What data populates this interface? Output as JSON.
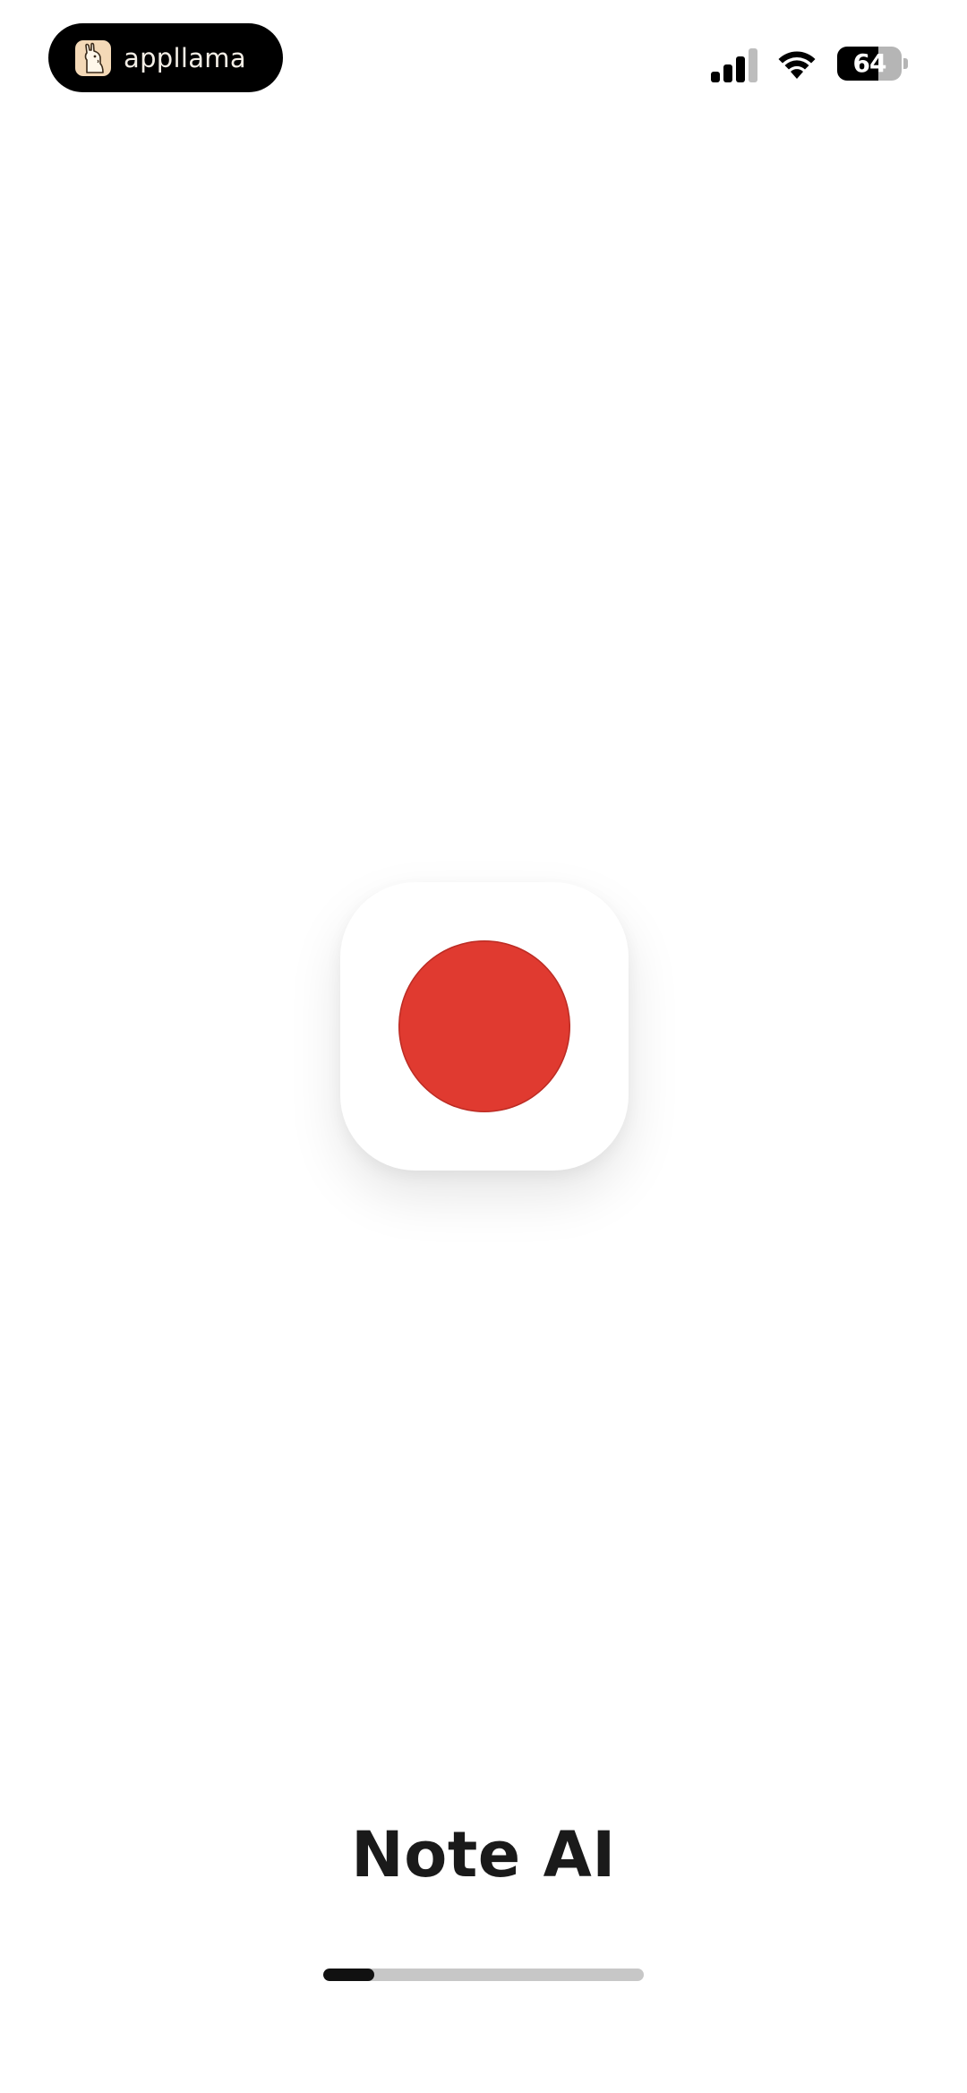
{
  "status_bar": {
    "brand_icon": "llama-logo-icon",
    "brand_name": "appllama",
    "signal_icon": "cellular-signal-icon",
    "signal_bars_active": 3,
    "signal_bars_total": 4,
    "wifi_icon": "wifi-icon",
    "battery_level": "64",
    "battery_fraction": 0.64
  },
  "splash": {
    "app_icon": "record-icon",
    "record_color": "#e03a30",
    "title": "Note AI"
  },
  "loading": {
    "progress_fraction": 0.16,
    "fill_color": "#111111",
    "track_color": "#c7c7c7"
  }
}
